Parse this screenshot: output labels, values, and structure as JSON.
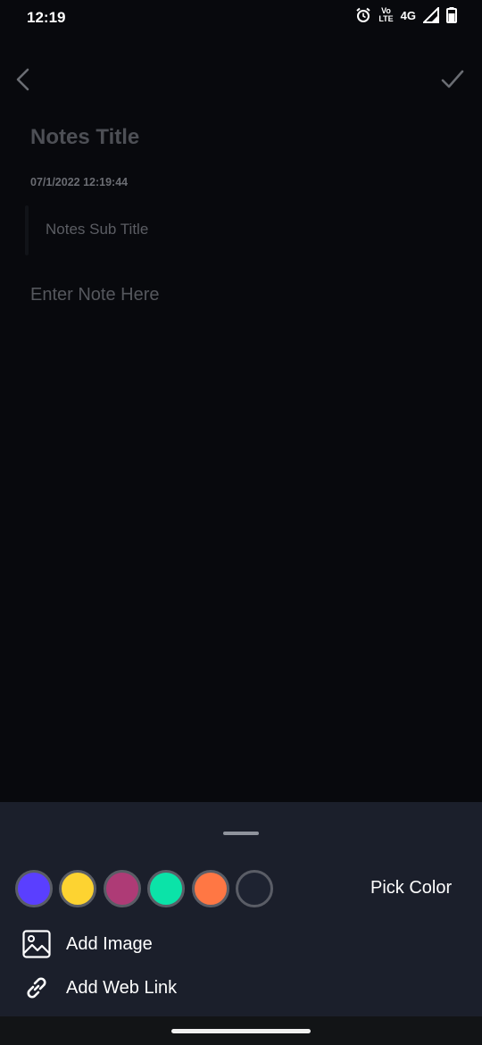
{
  "status_bar": {
    "time": "12:19",
    "volte_top": "Vo",
    "volte_bottom": "LTE",
    "network": "4G",
    "icons": [
      "alarm-icon",
      "volte-icon",
      "signal-icon",
      "battery-icon"
    ]
  },
  "toolbar": {
    "back_icon": "chevron-left-icon",
    "done_icon": "checkmark-icon"
  },
  "note": {
    "title_placeholder": "Notes Title",
    "datetime": "07/1/2022 12:19:44",
    "subtitle_placeholder": "Notes Sub Title",
    "body_placeholder": "Enter Note Here"
  },
  "bottom_sheet": {
    "colors": [
      "#5a3fff",
      "#fdd331",
      "#ae3b76",
      "#0be3a8",
      "#ff7744",
      "#1e2331"
    ],
    "pick_color_label": "Pick Color",
    "add_image_label": "Add Image",
    "add_web_link_label": "Add Web Link"
  }
}
